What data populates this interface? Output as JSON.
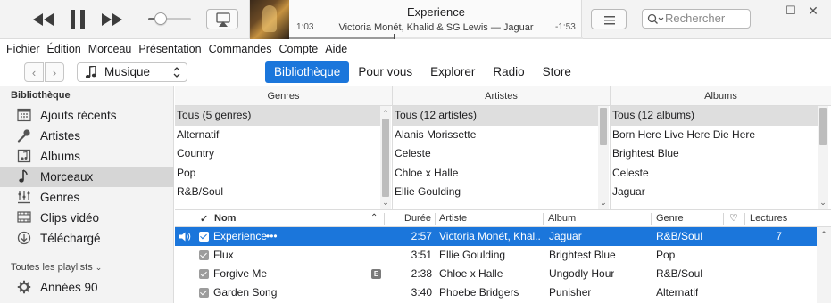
{
  "player": {
    "track_title": "Experience",
    "track_subtitle": "Victoria Monét, Khalid & SG Lewis — Jaguar",
    "elapsed": "1:03",
    "remaining": "-1:53",
    "progress_fraction": 0.36,
    "volume_fraction": 0.3
  },
  "search": {
    "placeholder": "Rechercher"
  },
  "menu": [
    "Fichier",
    "Édition",
    "Morceau",
    "Présentation",
    "Commandes",
    "Compte",
    "Aide"
  ],
  "nav": {
    "media_kind": "Musique",
    "tabs": [
      "Bibliothèque",
      "Pour vous",
      "Explorer",
      "Radio",
      "Store"
    ],
    "active_tab": 0
  },
  "sidebar": {
    "library_heading": "Bibliothèque",
    "library_items": [
      {
        "label": "Ajouts récents",
        "icon": "calendar-grid-icon"
      },
      {
        "label": "Artistes",
        "icon": "microphone-icon"
      },
      {
        "label": "Albums",
        "icon": "album-icon"
      },
      {
        "label": "Morceaux",
        "icon": "music-note-icon"
      },
      {
        "label": "Genres",
        "icon": "genres-icon"
      },
      {
        "label": "Clips vidéo",
        "icon": "video-icon"
      },
      {
        "label": "Téléchargé",
        "icon": "download-icon"
      }
    ],
    "selected_index": 3,
    "playlists_heading": "Toutes les playlists",
    "playlist_items": [
      {
        "label": "Années 90",
        "icon": "gear-icon"
      }
    ]
  },
  "browser": {
    "genres": {
      "header": "Genres",
      "items": [
        "Tous (5 genres)",
        "Alternatif",
        "Country",
        "Pop",
        "R&B/Soul"
      ]
    },
    "artists": {
      "header": "Artistes",
      "items": [
        "Tous (12 artistes)",
        "Alanis Morissette",
        "Celeste",
        "Chloe x Halle",
        "Ellie Goulding"
      ]
    },
    "albums": {
      "header": "Albums",
      "items": [
        "Tous (12 albums)",
        "Born Here Live Here Die Here",
        "Brightest Blue",
        "Celeste",
        "Jaguar"
      ]
    }
  },
  "songs": {
    "headers": {
      "name": "Nom",
      "duration": "Durée",
      "artist": "Artiste",
      "album": "Album",
      "genre": "Genre",
      "plays": "Lectures"
    },
    "rows": [
      {
        "name": "Experience",
        "more": "•••",
        "duration": "2:57",
        "artist": "Victoria Monét, Khal...",
        "album": "Jaguar",
        "genre": "R&B/Soul",
        "plays": "7",
        "playing": true,
        "explicit": false
      },
      {
        "name": "Flux",
        "more": "",
        "duration": "3:51",
        "artist": "Ellie Goulding",
        "album": "Brightest Blue",
        "genre": "Pop",
        "plays": "",
        "playing": false,
        "explicit": false
      },
      {
        "name": "Forgive Me",
        "more": "",
        "duration": "2:38",
        "artist": "Chloe x Halle",
        "album": "Ungodly Hour",
        "genre": "R&B/Soul",
        "plays": "",
        "playing": false,
        "explicit": true
      },
      {
        "name": "Garden Song",
        "more": "",
        "duration": "3:40",
        "artist": "Phoebe Bridgers",
        "album": "Punisher",
        "genre": "Alternatif",
        "plays": "",
        "playing": false,
        "explicit": false
      }
    ],
    "explicit_badge": "E"
  },
  "colors": {
    "accent": "#1b76db",
    "sidebar_bg": "#f3f3f3"
  }
}
